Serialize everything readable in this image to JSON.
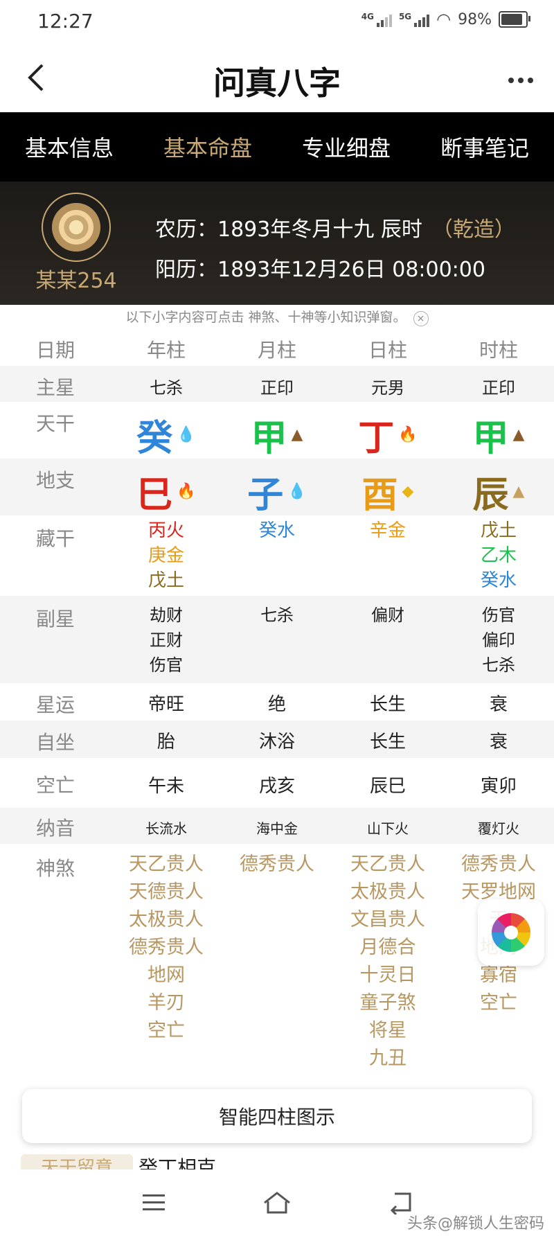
{
  "status": {
    "time": "12:27",
    "net1": "4G",
    "net2": "5G",
    "battery": "98%"
  },
  "appbar": {
    "title": "问真八字",
    "back_icon": "chevron-left-icon",
    "more_icon": "more-dots-icon"
  },
  "tabs": [
    "基本信息",
    "基本命盘",
    "专业细盘",
    "断事笔记"
  ],
  "hero": {
    "name": "某某254",
    "lunar": "农历：1893年冬月十九 辰时",
    "qian": "（乾造）",
    "solar": "阳历：1893年12月26日 08:00:00"
  },
  "hint": {
    "text": "以下小字内容可点击 神煞、十神等小知识弹窗。",
    "close": "×"
  },
  "table": {
    "header": {
      "label": "日期",
      "cols": [
        "年柱",
        "月柱",
        "日柱",
        "时柱"
      ]
    },
    "zhuxing": {
      "label": "主星",
      "cols": [
        "七杀",
        "正印",
        "元男",
        "正印"
      ]
    },
    "tiangan": {
      "label": "天干",
      "cols": [
        {
          "char": "癸",
          "color": "#2f86d8",
          "icon": "water-drops-icon"
        },
        {
          "char": "甲",
          "color": "#19c24a",
          "icon": "wood-icon"
        },
        {
          "char": "丁",
          "color": "#d8261c",
          "icon": "fire-icon"
        },
        {
          "char": "甲",
          "color": "#19c24a",
          "icon": "wood-icon"
        }
      ]
    },
    "dizhi": {
      "label": "地支",
      "cols": [
        {
          "char": "巳",
          "color": "#d8261c",
          "icon": "fire-icon"
        },
        {
          "char": "子",
          "color": "#2f86d8",
          "icon": "water-drops-icon"
        },
        {
          "char": "酉",
          "color": "#e89b18",
          "icon": "metal-icon"
        },
        {
          "char": "辰",
          "color": "#8a6a1c",
          "icon": "earth-icon"
        }
      ]
    },
    "canggan": {
      "label": "藏干",
      "cols": [
        [
          {
            "text": "丙火",
            "color": "#d8261c"
          },
          {
            "text": "庚金",
            "color": "#e89b18"
          },
          {
            "text": "戊土",
            "color": "#8a6a1c"
          }
        ],
        [
          {
            "text": "癸水",
            "color": "#2f86d8"
          }
        ],
        [
          {
            "text": "辛金",
            "color": "#e89b18"
          }
        ],
        [
          {
            "text": "戊土",
            "color": "#8a6a1c"
          },
          {
            "text": "乙木",
            "color": "#19c24a"
          },
          {
            "text": "癸水",
            "color": "#2f86d8"
          }
        ]
      ]
    },
    "fuxing": {
      "label": "副星",
      "cols": [
        [
          "劫财",
          "正财",
          "伤官"
        ],
        [
          "七杀"
        ],
        [
          "偏财"
        ],
        [
          "伤官",
          "偏印",
          "七杀"
        ]
      ]
    },
    "xingyun": {
      "label": "星运",
      "cols": [
        "帝旺",
        "绝",
        "长生",
        "衰"
      ]
    },
    "zizuo": {
      "label": "自坐",
      "cols": [
        "胎",
        "沐浴",
        "长生",
        "衰"
      ]
    },
    "kongwang": {
      "label": "空亡",
      "cols": [
        "午未",
        "戌亥",
        "辰巳",
        "寅卯"
      ]
    },
    "nayin": {
      "label": "纳音",
      "cols": [
        "长流水",
        "海中金",
        "山下火",
        "覆灯火"
      ]
    },
    "shensha": {
      "label": "神煞",
      "cols": [
        [
          "天乙贵人",
          "天德贵人",
          "太极贵人",
          "德秀贵人",
          "地网",
          "羊刃",
          "空亡"
        ],
        [
          "德秀贵人"
        ],
        [
          "天乙贵人",
          "太极贵人",
          "文昌贵人",
          "月德合",
          "十灵日",
          "童子煞",
          "将星",
          "九丑"
        ],
        [
          "德秀贵人",
          "天罗地网",
          "天",
          "地网",
          "寡宿",
          "空亡"
        ]
      ]
    }
  },
  "button": {
    "label": "智能四柱图示"
  },
  "partial": {
    "badge": "天干留意",
    "text": "癸丁相克"
  },
  "navbar": {
    "menu_icon": "menu-icon",
    "home_icon": "home-icon",
    "back_icon": "back-arrow-icon"
  },
  "watermark": "头条@解锁人生密码",
  "fab_icon": "color-wheel-icon"
}
